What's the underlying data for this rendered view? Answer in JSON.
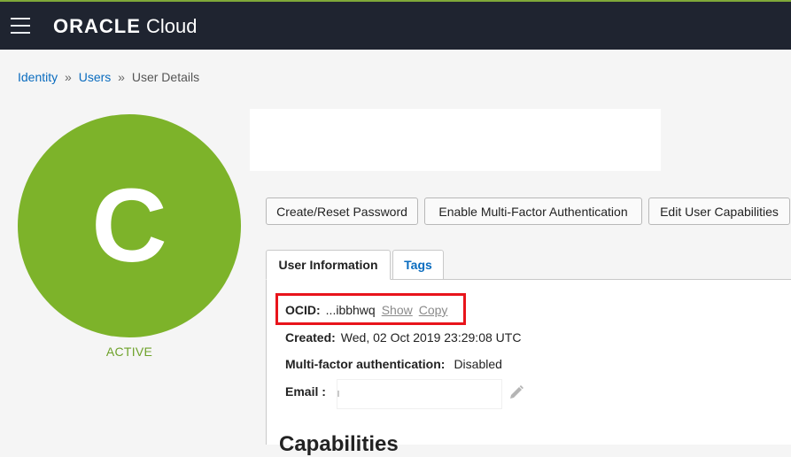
{
  "header": {
    "menu_icon": "hamburger-menu-icon",
    "logo_brand": "ORACLE",
    "logo_product": "Cloud"
  },
  "breadcrumb": {
    "items": [
      "Identity",
      "Users",
      "User Details"
    ],
    "separator": "»"
  },
  "user": {
    "avatar_letter": "C",
    "status": "ACTIVE",
    "avatar_color": "#7db32a"
  },
  "actions": {
    "create_reset_password": "Create/Reset Password",
    "enable_mfa": "Enable Multi-Factor Authentication",
    "edit_capabilities": "Edit User Capabilities"
  },
  "tabs": [
    {
      "label": "User Information",
      "active": true
    },
    {
      "label": "Tags",
      "active": false
    }
  ],
  "details": {
    "ocid_label": "OCID:",
    "ocid_value": "...ibbhwq",
    "ocid_show": "Show",
    "ocid_copy": "Copy",
    "created_label": "Created:",
    "created_value": "Wed, 02 Oct 2019 23:29:08 UTC",
    "mfa_label": "Multi-factor authentication:",
    "mfa_value": "Disabled",
    "email_label": "Email",
    "email_colon": ":",
    "email_edit_icon": "pencil-icon"
  },
  "sections": {
    "capabilities_heading": "Capabilities"
  },
  "colors": {
    "topbar": "#1f2430",
    "link": "#0a6cbf",
    "highlight": "#e8141b",
    "status_active": "#6ea22b"
  }
}
